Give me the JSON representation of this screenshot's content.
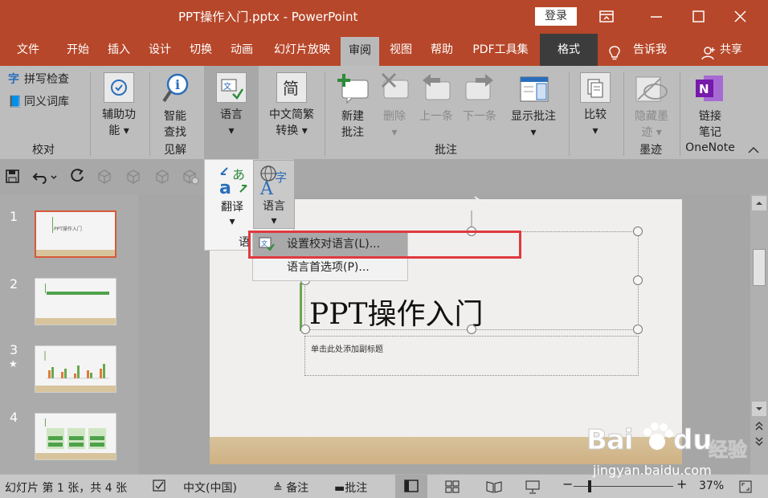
{
  "window": {
    "title": "PPT操作入门.pptx  -  PowerPoint",
    "login_label": "登录"
  },
  "tabs": [
    {
      "label": "文件"
    },
    {
      "label": "开始"
    },
    {
      "label": "插入"
    },
    {
      "label": "设计"
    },
    {
      "label": "切换"
    },
    {
      "label": "动画"
    },
    {
      "label": "幻灯片放映"
    },
    {
      "label": "审阅"
    },
    {
      "label": "视图"
    },
    {
      "label": "帮助"
    },
    {
      "label": "PDF工具集"
    },
    {
      "label": "格式"
    }
  ],
  "tell_me": "告诉我",
  "share": "共享",
  "ribbon": {
    "proofing": {
      "spell": "拼写检查",
      "thesaurus": "同义词库",
      "label": "校对"
    },
    "accessibility": {
      "line1": "辅助功",
      "line2": "能"
    },
    "insights": {
      "line1": "智能",
      "line2": "查找",
      "label": "见解"
    },
    "language": {
      "label": "语言"
    },
    "chinese": {
      "line1": "中文简繁",
      "line2": "转换"
    },
    "comments": {
      "new1": "新建",
      "new2": "批注",
      "delete": "删除",
      "prev": "上一条",
      "next": "下一条",
      "show": "显示批注",
      "label": "批注"
    },
    "compare": {
      "label": "比较"
    },
    "ink": {
      "hide1": "隐藏墨",
      "hide2": "迹",
      "label": "墨迹"
    },
    "onenote": {
      "line1": "链接",
      "line2": "笔记",
      "label": "OneNote"
    }
  },
  "dropdown": {
    "translate": "翻译",
    "language": "语言",
    "group_fragment": "语",
    "items": [
      {
        "label": "设置校对语言(L)..."
      },
      {
        "label": "语言首选项(P)..."
      }
    ]
  },
  "slides": [
    {
      "num": "1",
      "mini_title": "PPT操作入门"
    },
    {
      "num": "2"
    },
    {
      "num": "3",
      "star": "★"
    },
    {
      "num": "4"
    }
  ],
  "slide": {
    "title": "PPT操作入门",
    "subtitle": "单击此处添加副标题"
  },
  "status": {
    "slide_info": "幻灯片 第 1 张，共 4 张",
    "language": "中文(中国)",
    "notes": "备注",
    "comments": "批注",
    "zoom": "37%"
  },
  "watermark": {
    "text": "Bai",
    "du": "du",
    "cn": "经验",
    "url": "jingyan.baidu.com"
  },
  "colors": {
    "accent": "#b7472a",
    "highlight_box": "#e0393e",
    "onenote": "#7719aa"
  }
}
